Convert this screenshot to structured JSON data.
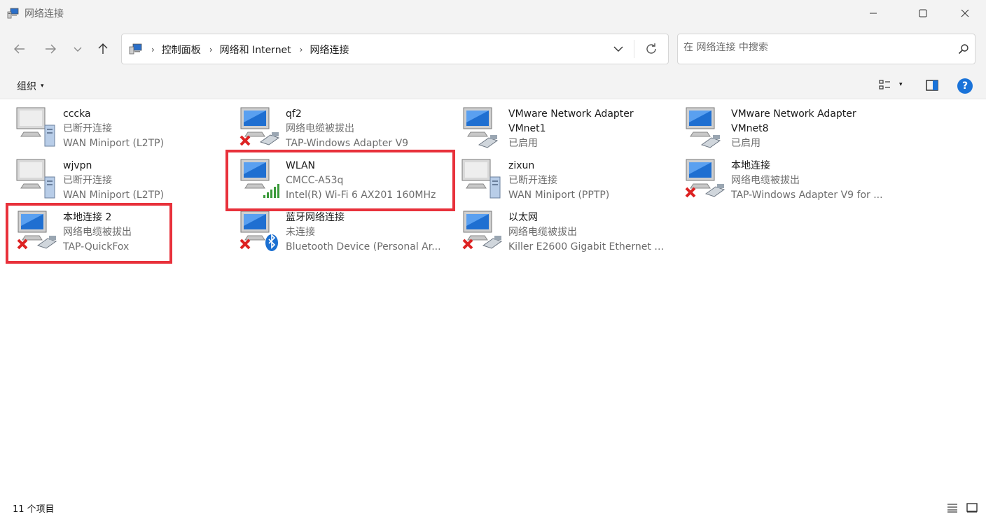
{
  "window": {
    "title": "网络连接",
    "icon": "network-connections-icon",
    "buttons": [
      "minimize-icon",
      "maximize-icon",
      "close-icon"
    ]
  },
  "nav": {
    "back": "arrow-left-icon",
    "forward": "arrow-right-icon",
    "recent": "chevron-down-icon",
    "up": "arrow-up-icon"
  },
  "address": {
    "crumbs": [
      "控制面板",
      "网络和 Internet",
      "网络连接"
    ]
  },
  "search": {
    "placeholder": "在 网络连接 中搜索"
  },
  "toolbar": {
    "organize_label": "组织",
    "organize_caret": "▾",
    "view_caret": "▾",
    "help_label": "?"
  },
  "connections": [
    {
      "name": "cccka",
      "status": "已断开连接",
      "device": "WAN Miniport (L2TP)",
      "icon": "vpn-server-icon",
      "disconnected": false
    },
    {
      "name": "qf2",
      "status": "网络电缆被拔出",
      "device": "TAP-Windows Adapter V9",
      "icon": "ethernet-icon",
      "disconnected": true
    },
    {
      "name": "VMware Network Adapter VMnet1",
      "status": "已启用",
      "device": "",
      "icon": "ethernet-icon",
      "disconnected": false
    },
    {
      "name": "VMware Network Adapter VMnet8",
      "status": "已启用",
      "device": "",
      "icon": "ethernet-icon",
      "disconnected": false
    },
    {
      "name": "wjvpn",
      "status": "已断开连接",
      "device": "WAN Miniport (L2TP)",
      "icon": "vpn-server-icon",
      "disconnected": false
    },
    {
      "name": "WLAN",
      "status": "CMCC-A53q",
      "device": "Intel(R) Wi-Fi 6 AX201 160MHz",
      "icon": "wifi-signal-icon",
      "disconnected": false
    },
    {
      "name": "zixun",
      "status": "已断开连接",
      "device": "WAN Miniport (PPTP)",
      "icon": "vpn-server-icon",
      "disconnected": false
    },
    {
      "name": "本地连接",
      "status": "网络电缆被拔出",
      "device": "TAP-Windows Adapter V9 for ...",
      "icon": "ethernet-icon",
      "disconnected": true
    },
    {
      "name": "本地连接 2",
      "status": "网络电缆被拔出",
      "device": "TAP-QuickFox",
      "icon": "ethernet-icon",
      "disconnected": true
    },
    {
      "name": "蓝牙网络连接",
      "status": "未连接",
      "device": "Bluetooth Device (Personal Ar...",
      "icon": "bluetooth-icon",
      "disconnected": true
    },
    {
      "name": "以太网",
      "status": "网络电缆被拔出",
      "device": "Killer E2600 Gigabit Ethernet C...",
      "icon": "ethernet-icon",
      "disconnected": true
    }
  ],
  "status": {
    "count": "11 个项目"
  },
  "colors": {
    "highlight": "#e8313b",
    "accent": "#1a73d9",
    "chrome": "#f3f3f3"
  }
}
